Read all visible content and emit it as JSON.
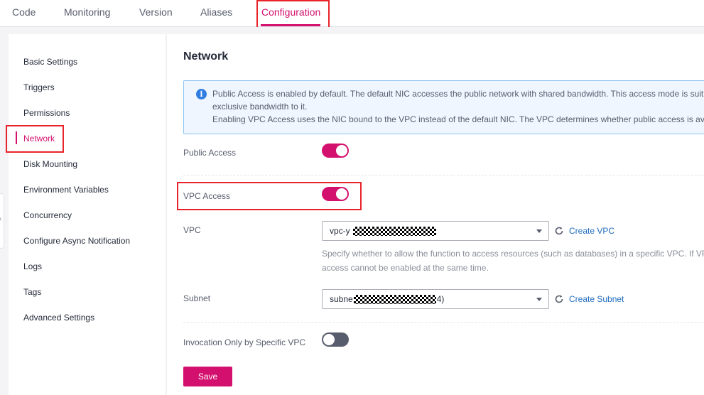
{
  "tabs": [
    {
      "label": "Code"
    },
    {
      "label": "Monitoring"
    },
    {
      "label": "Version"
    },
    {
      "label": "Aliases"
    },
    {
      "label": "Configuration",
      "active": true
    }
  ],
  "sidebar": {
    "items": [
      {
        "label": "Basic Settings"
      },
      {
        "label": "Triggers"
      },
      {
        "label": "Permissions"
      },
      {
        "label": "Network",
        "active": true
      },
      {
        "label": "Disk Mounting"
      },
      {
        "label": "Environment Variables"
      },
      {
        "label": "Concurrency"
      },
      {
        "label": "Configure Async Notification"
      },
      {
        "label": "Logs"
      },
      {
        "label": "Tags"
      },
      {
        "label": "Advanced Settings"
      }
    ]
  },
  "main": {
    "title": "Network",
    "info": {
      "icon": "info-icon",
      "line1": "Public Access is enabled by default. The default NIC accesses the public network with shared bandwidth. This access mode is suit",
      "line2": "exclusive bandwidth to it.",
      "line3": "Enabling VPC Access uses the NIC bound to the VPC instead of the default NIC. The VPC determines whether public access is av"
    },
    "public_access": {
      "label": "Public Access",
      "enabled": true
    },
    "vpc_access": {
      "label": "VPC Access",
      "enabled": true
    },
    "vpc": {
      "label": "VPC",
      "value_prefix": "vpc-y",
      "value_suffix": ")",
      "action": "Create VPC",
      "help1": "Specify whether to allow the function to access resources (such as databases) in a specific VPC. If VP",
      "help2": "access cannot be enabled at the same time."
    },
    "subnet": {
      "label": "Subnet",
      "value_prefix": "subne",
      "value_suffix": "4)",
      "action": "Create Subnet"
    },
    "invocation_only": {
      "label": "Invocation Only by Specific VPC",
      "enabled": false
    },
    "save_label": "Save"
  },
  "colors": {
    "accent": "#d4106e",
    "highlight": "#e8232a",
    "link": "#1f6bbf",
    "info_bg": "#f0f6ff"
  }
}
